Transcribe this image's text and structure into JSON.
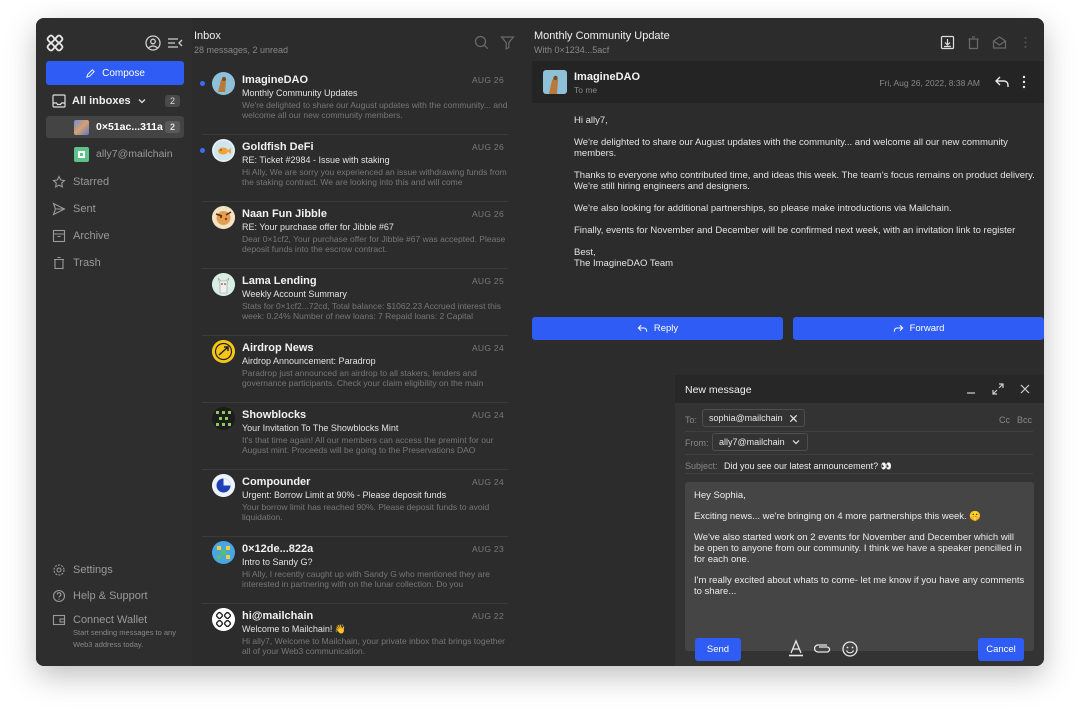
{
  "sidebar": {
    "compose_label": "Compose",
    "all_inboxes_label": "All inboxes",
    "all_inboxes_count": "2",
    "accounts": [
      {
        "label": "0×51ac...311a",
        "count": "2"
      },
      {
        "label": "ally7@mailchain"
      }
    ],
    "folders": [
      "Starred",
      "Sent",
      "Archive",
      "Trash"
    ],
    "settings_label": "Settings",
    "help_label": "Help & Support",
    "connect_label": "Connect Wallet",
    "connect_sub": "Start sending messages to any Web3 address today."
  },
  "list": {
    "title": "Inbox",
    "subtitle": "28 messages, 2 unread",
    "messages": [
      {
        "sender": "ImagineDAO",
        "date": "AUG 26",
        "subject": "Monthly Community Updates",
        "preview": "We're delighted to share our August updates with the community... and welcome all our new community members.",
        "unread": true
      },
      {
        "sender": "Goldfish DeFi",
        "date": "AUG 26",
        "subject": "RE: Ticket #2984 - Issue with staking",
        "preview": "Hi Ally, We are sorry you experienced an issue withdrawing funds from the staking contract. We are looking into this and will come",
        "unread": true
      },
      {
        "sender": "Naan Fun Jibble",
        "date": "AUG 26",
        "subject": "RE: Your purchase offer for Jibble #67",
        "preview": "Dear 0×1cf2, Your purchase offer for Jibble #67 was accepted. Please deposit funds into the escrow contract.",
        "unread": false
      },
      {
        "sender": "Lama Lending",
        "date": "AUG 25",
        "subject": "Weekly Account Summary",
        "preview": "Stats for 0×1cf2...72cd, Total balance: $1062.23 Accrued interest this week: 0.24% Number of new loans: 7 Repaid loans: 2 Capital",
        "unread": false
      },
      {
        "sender": "Airdrop News",
        "date": "AUG 24",
        "subject": "Airdrop Announcement: Paradrop",
        "preview": "Paradrop just announced an airdrop to all stakers, lenders and governance participants. Check your claim eligibility on the main",
        "unread": false
      },
      {
        "sender": "Showblocks",
        "date": "AUG 24",
        "subject": "Your Invitation To The Showblocks Mint",
        "preview": "It's that time again! All our members can access the premint for our August mint. Proceeds will be going to the Preservations DAO",
        "unread": false
      },
      {
        "sender": "Compounder",
        "date": "AUG 24",
        "subject": "Urgent: Borrow Limit at 90% - Please deposit funds",
        "preview": "Your borrow limit has reached 90%. Please deposit funds to avoid liquidation.",
        "unread": false
      },
      {
        "sender": "0×12de...822a",
        "date": "AUG 23",
        "subject": "Intro to Sandy G?",
        "preview": "Hi Ally, I recently caught up with Sandy G who mentioned they are interested in partnering with on the lunar collection. Do you",
        "unread": false
      },
      {
        "sender": "hi@mailchain",
        "date": "AUG 22",
        "subject": "Welcome to Mailchain! 👋",
        "preview": "Hi ally7, Welcome to Mailchain, your private inbox that brings together all of your Web3 communication.",
        "unread": false
      }
    ]
  },
  "reader": {
    "title": "Monthly Community Update",
    "subtitle": "With 0×1234...5acf",
    "from": "ImagineDAO",
    "to": "To me",
    "date": "Fri, Aug 26, 2022, 8:38 AM",
    "body": [
      "Hi ally7,",
      "We're delighted to share our August updates with the community... and welcome all our new community members.",
      "Thanks to everyone who contributed time, and ideas this week. The team's focus remains on product delivery. We're still hiring engineers and designers.",
      "We're also looking for additional partnerships, so please make introductions via Mailchain.",
      "Finally, events for November and December will be confirmed next week, with an invitation link to register",
      "Best,",
      "The ImagineDAO Team"
    ],
    "reply_label": "Reply",
    "forward_label": "Forward"
  },
  "composer": {
    "title": "New message",
    "to_label": "To:",
    "to_value": "sophia@mailchain",
    "cc_label": "Cc",
    "bcc_label": "Bcc",
    "from_label": "From:",
    "from_value": "ally7@mailchain",
    "subject_label": "Subject:",
    "subject_value": "Did you see our latest announcement? 👀",
    "body": [
      "Hey Sophia,",
      "Exciting news... we're bringing on 4 more partnerships this week. 🤫",
      "We've also started work on 2 events for November and December which will be open to anyone from our community. I think we have a speaker pencilled in for each one.",
      "I'm really excited about whats to come- let me know if you have any comments to share..."
    ],
    "send_label": "Send",
    "cancel_label": "Cancel"
  },
  "colors": {
    "accent": "#2f5cf5",
    "unread_dot": "#3b6cff",
    "background": "#2c2c2c"
  }
}
